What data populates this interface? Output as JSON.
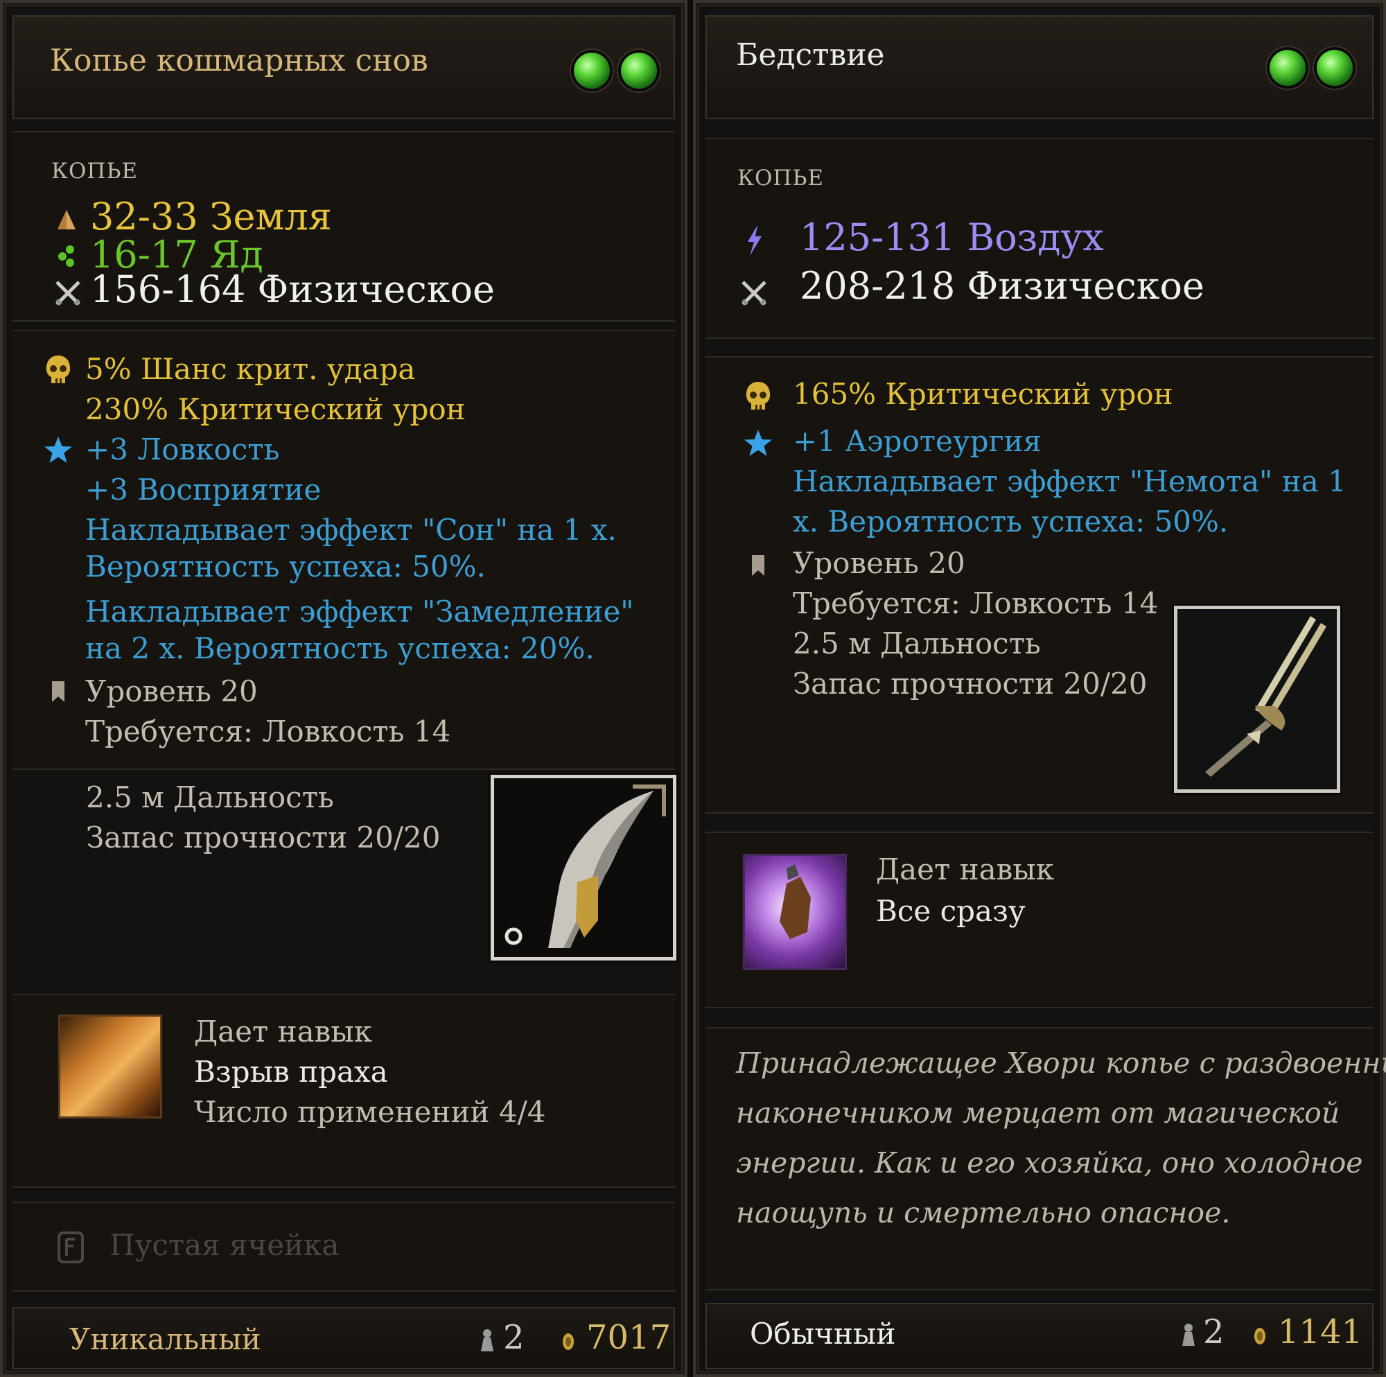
{
  "left": {
    "title": "Копье кошмарных снов",
    "type": "КОПЬЕ",
    "damage": [
      {
        "text": "32-33 Земля",
        "icon": "earth-icon"
      },
      {
        "text": "16-17 Яд",
        "icon": "poison-icon"
      },
      {
        "text": "156-164 Физическое",
        "icon": "physical-swords-icon"
      }
    ],
    "stats": {
      "crit_chance": "5%  Шанс крит. удара",
      "crit_damage": "230%  Критический урон",
      "finesse": "+3  Ловкость",
      "wits": "+3  Восприятие",
      "effect1_line1": "Накладывает эффект \"Сон\" на 1 х.",
      "effect1_line2": "Вероятность успеха: 50%.",
      "effect2_line1": "Накладывает эффект \"Замедление\"",
      "effect2_line2": "на 2 х. Вероятность успеха: 20%."
    },
    "info": {
      "level": "Уровень  20",
      "requires": "Требуется: Ловкость 14",
      "range": "2.5 м  Дальность",
      "durability": "Запас прочности  20/20"
    },
    "skill": {
      "label": "Дает навык",
      "name": "Взрыв праха",
      "uses": "Число применений  4/4"
    },
    "empty_slot": "Пустая ячейка",
    "footer": {
      "rarity": "Уникальный",
      "weight": "2",
      "value": "7017"
    }
  },
  "right": {
    "title": "Бедствие",
    "type": "КОПЬЕ",
    "damage": [
      {
        "text": "125-131 Воздух",
        "icon": "air-lightning-icon"
      },
      {
        "text": "208-218 Физическое",
        "icon": "physical-swords-icon"
      }
    ],
    "stats": {
      "crit_damage": "165%  Критический урон",
      "aerotheurge": "+1  Аэротеургия",
      "effect_line1": "Накладывает эффект \"Немота\" на 1",
      "effect_line2": "х. Вероятность успеха: 50%."
    },
    "info": {
      "level": "Уровень  20",
      "requires": "Требуется: Ловкость 14",
      "range": "2.5 м  Дальность",
      "durability": "Запас прочности  20/20"
    },
    "skill": {
      "label": "Дает навык",
      "name": "Все сразу"
    },
    "description": [
      "Принадлежащее Хвори копье с раздвоенным",
      "наконечником мерцает от магической",
      "энергии. Как и его хозяйка, оно холодное",
      "наощупь и смертельно опасное."
    ],
    "footer": {
      "rarity": "Обычный",
      "weight": "2",
      "value": "1141"
    }
  },
  "colors": {
    "earth": "#e8c33c",
    "poison": "#6cc52a",
    "air": "#9f8cf5",
    "crit": "#e6c23a",
    "bonus": "#3b9fd6",
    "gem": "#5fd83a"
  }
}
